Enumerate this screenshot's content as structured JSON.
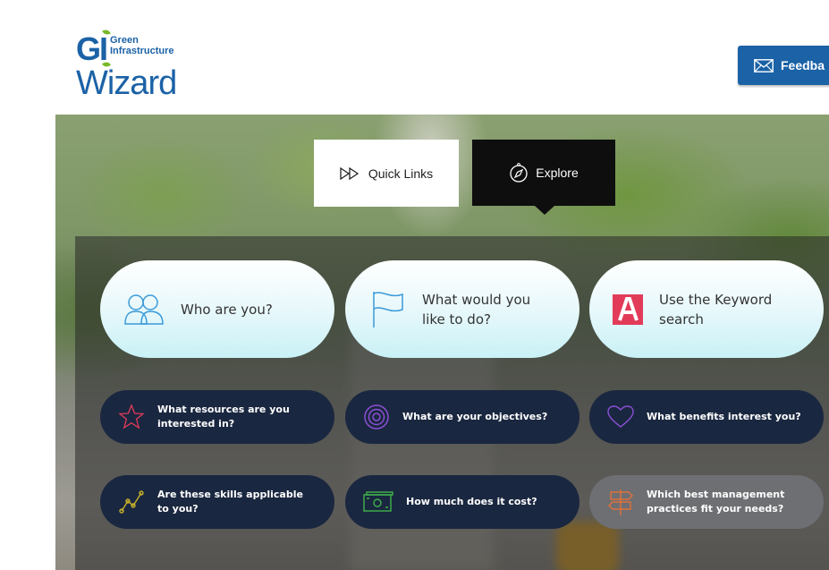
{
  "logo": {
    "gi": "GI",
    "line1": "Green",
    "line2": "Infrastructure",
    "wizard": "Wizard"
  },
  "header": {
    "feedback_label": "Feedba",
    "feedback_icon": "envelope-icon"
  },
  "tabs": [
    {
      "label": "Quick Links",
      "icon": "fast-forward-icon",
      "active": false
    },
    {
      "label": "Explore",
      "icon": "compass-icon",
      "active": true
    }
  ],
  "primary_cards": [
    {
      "label": "Who are you?",
      "icon": "people-icon"
    },
    {
      "label": "What would you like to do?",
      "icon": "flag-icon"
    },
    {
      "label": "Use the Keyword search",
      "icon": "letter-a-icon"
    }
  ],
  "secondary_cards": [
    {
      "label": "What resources are you interested in?",
      "icon": "star-icon"
    },
    {
      "label": "What are your objectives?",
      "icon": "target-icon"
    },
    {
      "label": "What benefits interest you?",
      "icon": "heart-icon"
    },
    {
      "label": "Are these skills applicable to you?",
      "icon": "chart-line-icon"
    },
    {
      "label": "How much does it cost?",
      "icon": "money-icon"
    },
    {
      "label": "Which best management practices fit your needs?",
      "icon": "signpost-icon"
    }
  ],
  "colors": {
    "brand_blue": "#1b62a6",
    "brand_green": "#76b82a",
    "card_dark": "#1a2740",
    "card_grey": "#6d6f73",
    "icon_blue": "#3a9ad9",
    "icon_red": "#e23b5a",
    "icon_purple": "#8b4fd6",
    "icon_yellow": "#c9b22a",
    "icon_green": "#3fb44a",
    "icon_orange": "#e0703a"
  }
}
